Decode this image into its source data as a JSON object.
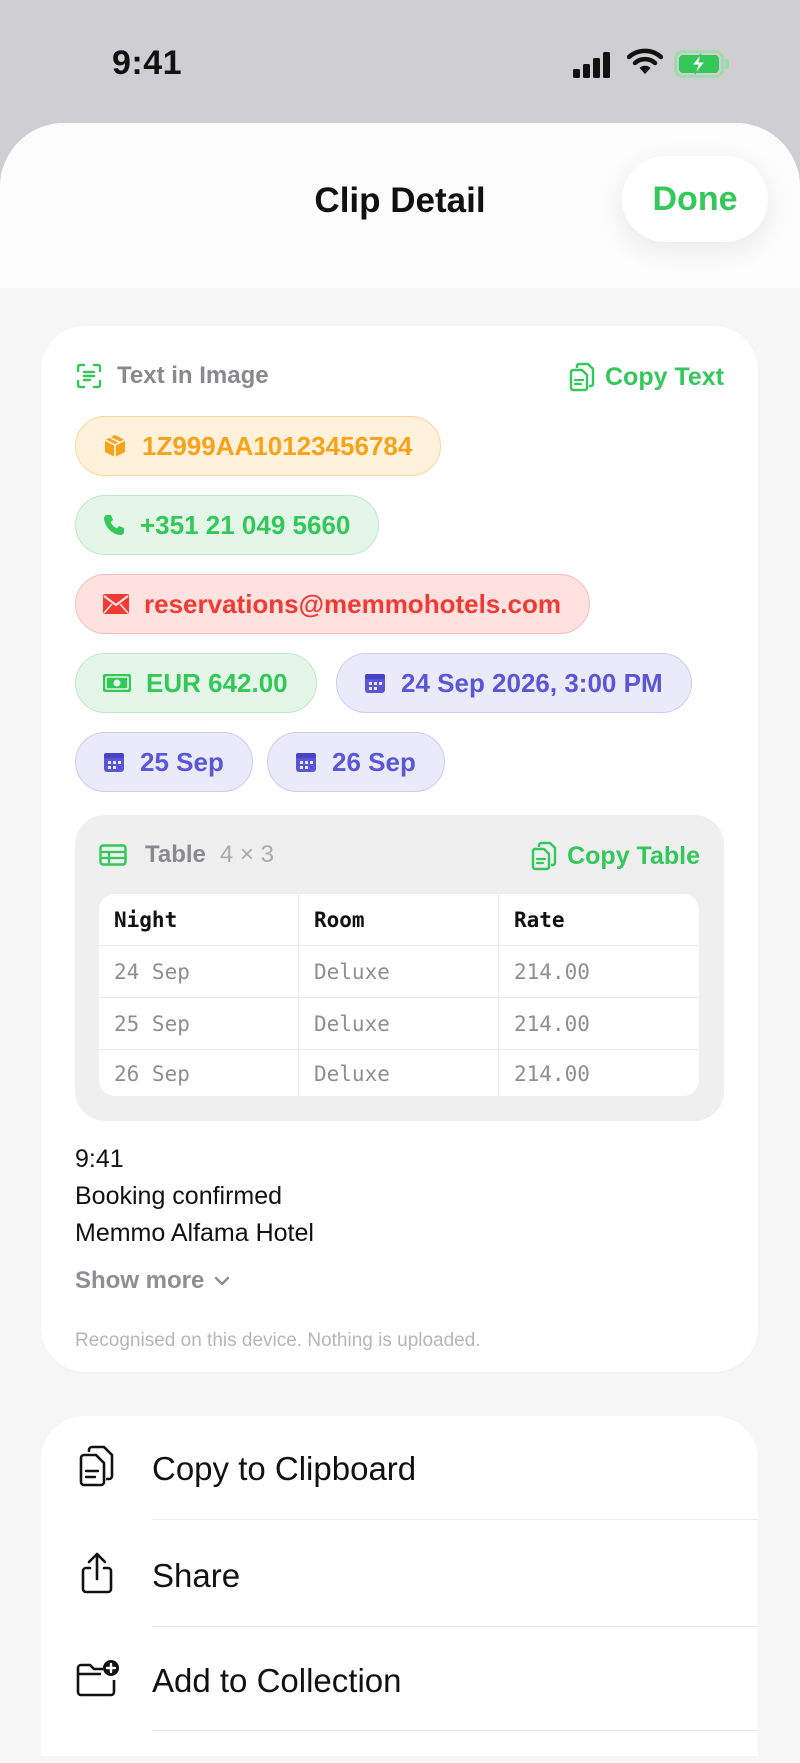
{
  "status_bar": {
    "time": "9:41"
  },
  "nav": {
    "title": "Clip Detail",
    "done_label": "Done"
  },
  "text_section": {
    "label": "Text in Image",
    "copy_label": "Copy Text",
    "chips": {
      "tracking": "1Z999AA10123456784",
      "phone": "+351 21 049 5660",
      "email": "reservations@memmohotels.com",
      "amount": "EUR 642.00",
      "datetime": "24 Sep 2026, 3:00 PM",
      "date1": "25 Sep",
      "date2": "26 Sep"
    }
  },
  "table": {
    "label": "Table",
    "dims": "4 × 3",
    "copy_label": "Copy Table",
    "headers": [
      "Night",
      "Room",
      "Rate"
    ],
    "rows": [
      [
        "24 Sep",
        "Deluxe",
        "214.00"
      ],
      [
        "25 Sep",
        "Deluxe",
        "214.00"
      ],
      [
        "26 Sep",
        "Deluxe",
        "214.00"
      ]
    ]
  },
  "recognized_text": [
    "9:41",
    "Booking confirmed",
    "Memmo Alfama Hotel"
  ],
  "show_more_label": "Show more",
  "footnote": "Recognised on this device. Nothing is uploaded.",
  "actions": [
    {
      "label": "Copy to Clipboard",
      "icon": "copy-icon"
    },
    {
      "label": "Share",
      "icon": "share-icon"
    },
    {
      "label": "Add to Collection",
      "icon": "folder-add-icon"
    }
  ],
  "colors": {
    "accent": "#34c759",
    "orange": "#f7a21b",
    "red": "#ef3b34",
    "purple": "#5a56d6"
  }
}
